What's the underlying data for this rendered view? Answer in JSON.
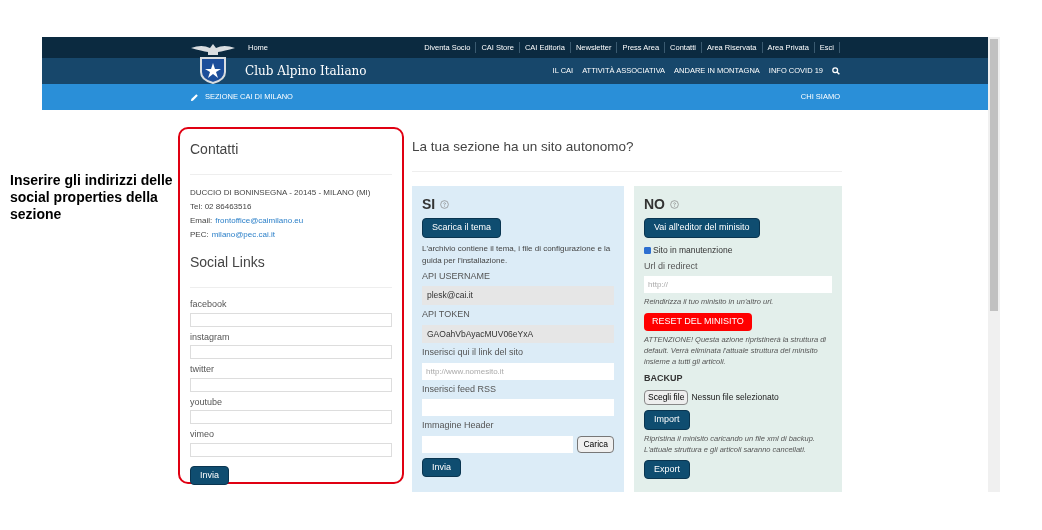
{
  "annotation": "Inserire gli indirizzi delle social properties della sezione",
  "top_nav": {
    "home": "Home",
    "links": [
      "Diventa Socio",
      "CAI Store",
      "CAI Editoria",
      "Newsletter",
      "Press Area",
      "Contatti",
      "Area Riservata",
      "Area Privata",
      "Esci"
    ]
  },
  "brand": "Club Alpino Italiano",
  "main_nav": [
    "IL CAI",
    "ATTIVITÀ ASSOCIATIVA",
    "ANDARE IN MONTAGNA",
    "INFO COVID 19"
  ],
  "section_bar": {
    "title": "SEZIONE CAI DI MILANO",
    "link": "CHI SIAMO"
  },
  "contacts": {
    "title": "Contatti",
    "address": "DUCCIO DI BONINSEGNA - 20145 - MILANO (MI)",
    "phone": "Tel: 02 86463516",
    "email_label": "Email:",
    "email": "frontoffice@caimilano.eu",
    "pec_label": "PEC:",
    "pec": "milano@pec.cai.it"
  },
  "social": {
    "title": "Social Links",
    "fields": [
      "facebook",
      "instagram",
      "twitter",
      "youtube",
      "vimeo"
    ],
    "submit": "Invia"
  },
  "question": "La tua sezione ha un sito autonomo?",
  "si": {
    "title": "SI",
    "download": "Scarica il tema",
    "description": "L'archivio contiene il tema, i file di configurazione e la guida per l'installazione.",
    "username_label": "API USERNAME",
    "username": "plesk@cai.it",
    "token_label": "API TOKEN",
    "token": "GAOahVbAyacMUV06eYxA",
    "site_label": "Inserisci qui il link del sito",
    "site_placeholder": "http://www.nomesito.it",
    "rss_label": "Inserisci feed RSS",
    "header_label": "Immagine Header",
    "upload": "Carica",
    "submit": "Invia"
  },
  "no": {
    "title": "NO",
    "editor": "Vai all'editor del minisito",
    "maintenance": {
      "label": "Sito in manutenzione",
      "checked": true
    },
    "redirect_label": "Url di redirect",
    "redirect_placeholder": "http://",
    "redirect_hint": "Reindirizza il tuo minisito in un'altro url.",
    "reset": "RESET DEL MINISITO",
    "reset_warning": "ATTENZIONE! Questa azione ripristinerà la struttura di default. Verrà eliminata l'attuale struttura del minisito insieme a tutti gli articoli.",
    "backup_title": "BACKUP",
    "choose_file": "Scegli file",
    "no_file": "Nessun file selezionato",
    "import": "Import",
    "import_hint": "Ripristina il minisito caricando un file xml di backup. L'attuale struttura e gli articoli saranno cancellati.",
    "export": "Export"
  }
}
